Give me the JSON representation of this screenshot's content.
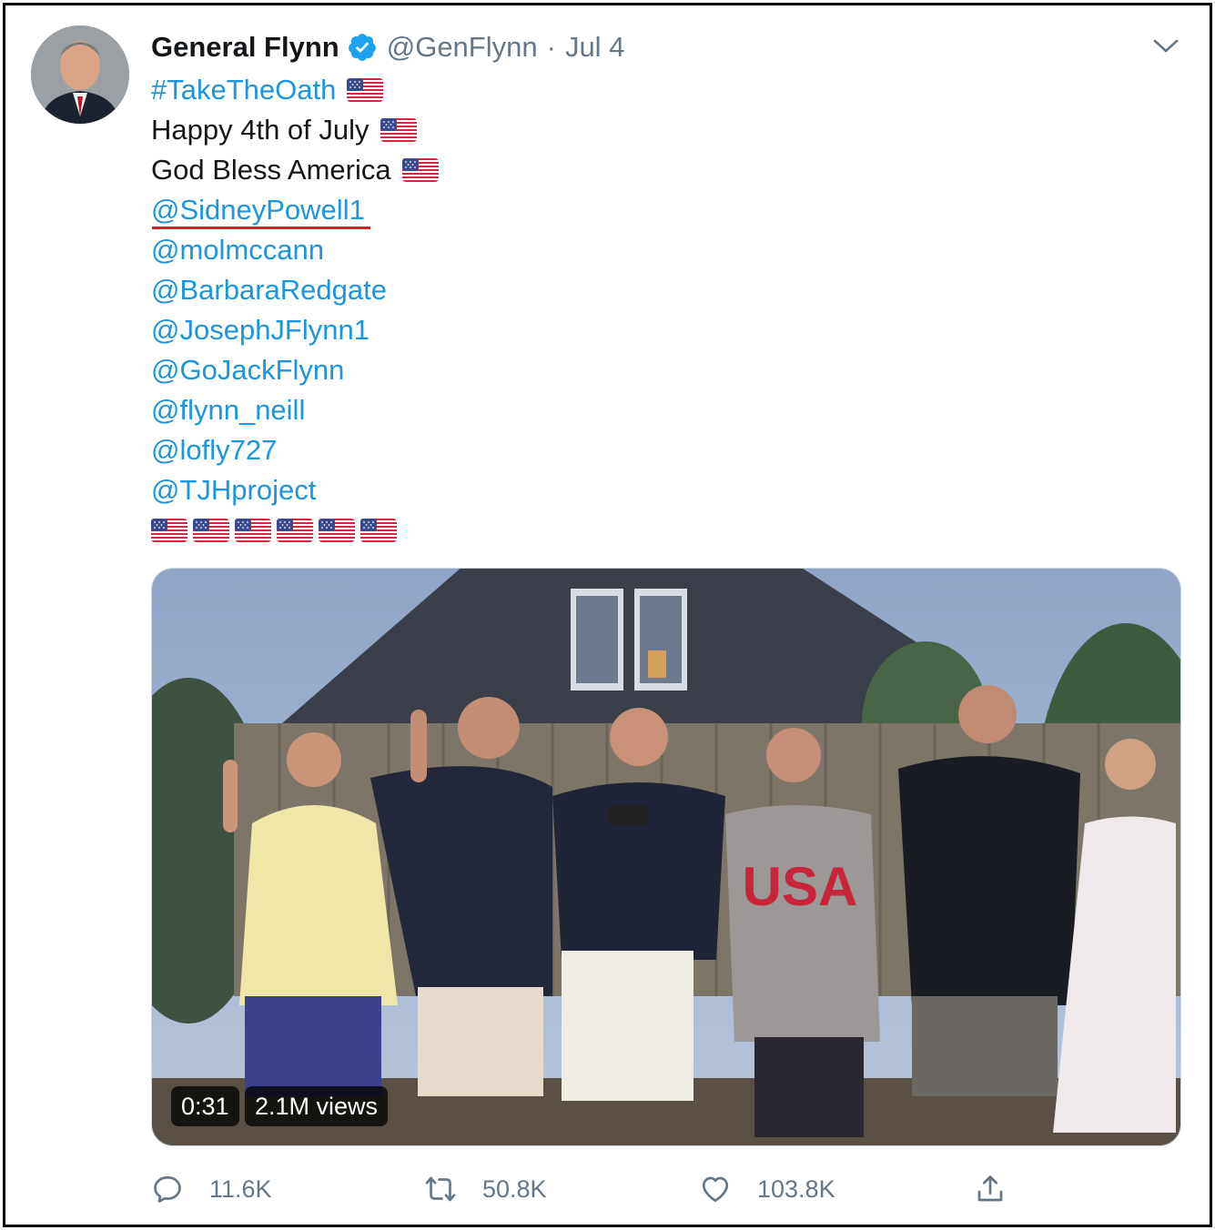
{
  "tweet": {
    "author_name": "General Flynn",
    "handle": "@GenFlynn",
    "separator": "·",
    "date": "Jul 4",
    "hashtag": "#TakeTheOath",
    "lines": [
      "Happy 4th of July",
      "God Bless America"
    ],
    "mentions": [
      "@SidneyPowell1",
      "@molmccann",
      "@BarbaraRedgate",
      "@JosephJFlynn1",
      "@GoJackFlynn",
      "@flynn_neill",
      "@lofly727",
      "@TJHproject"
    ],
    "flag_row_count": 6
  },
  "media": {
    "duration": "0:31",
    "views": "2.1M views",
    "shirt_text": "USA"
  },
  "actions": {
    "replies": "11.6K",
    "retweets": "50.8K",
    "likes": "103.8K"
  },
  "colors": {
    "link": "#1b95e0",
    "verified": "#1da1f2",
    "muted": "#657786",
    "annotation_underline": "#d21f1f"
  },
  "icons": [
    "verified-badge-icon",
    "chevron-down-icon",
    "us-flag-icon",
    "reply-icon",
    "retweet-icon",
    "like-icon",
    "share-icon"
  ]
}
